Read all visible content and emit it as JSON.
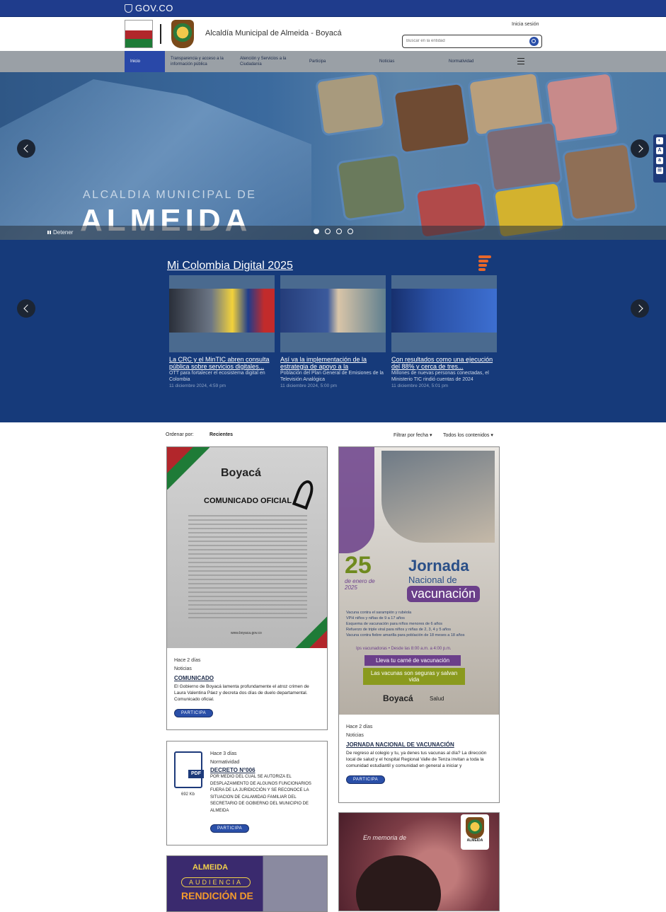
{
  "gov": {
    "brand": "GOV.CO"
  },
  "header": {
    "site_title": "Alcaldía Municipal de Almeida - Boyacá",
    "login": "Inicia sesión",
    "search_placeholder": "Buscar en la entidad"
  },
  "nav": {
    "items": [
      {
        "label": "Inicio"
      },
      {
        "label": "Transparencia y acceso a la información pública"
      },
      {
        "label": "Atención y Servicios a la Ciudadanía"
      },
      {
        "label": "Participa"
      },
      {
        "label": "Noticias"
      },
      {
        "label": "Normatividad"
      }
    ]
  },
  "hero": {
    "subtitle": "ALCALDIA MUNICIPAL DE",
    "title": "ALMEIDA",
    "stop_label": "Detener"
  },
  "digital": {
    "title": "Mi Colombia Digital 2025",
    "cards": [
      {
        "headline": "La CRC y el MinTIC abren consulta pública sobre servicios digitales...",
        "description": "OTT para fortalecer el ecosistema digital en Colombia",
        "date": "11 diciembre 2024, 4:59 pm"
      },
      {
        "headline": "Así va la implementación de la estrategia de apoyo a la",
        "description": "Población del Plan General de Emisiones de la Televisión Analógica",
        "date": "11 diciembre 2024, 5:00 pm"
      },
      {
        "headline": "Con resultados como una ejecución del 88% y cerca de tres...",
        "description": "Millones de nuevas personas conectadas, el Ministerio TIC rindió cuentas de 2024",
        "date": "11 diciembre 2024, 5:01 pm"
      }
    ]
  },
  "feed": {
    "sort_label": "Ordenar por:",
    "sort_value": "Recientes",
    "filter_date": "Filtrar por fecha",
    "filter_content": "Todos los contenidos",
    "participa": "PARTICIPA",
    "post1": {
      "poster_brand": "Boyacá",
      "poster_title": "COMUNICADO OFICIAL",
      "poster_url": "www.boyaca.gov.co",
      "age": "Hace 2 días",
      "category": "Noticias",
      "title": "COMUNICADO",
      "body": "El Gobierno de Boyacá lamenta profundamente el atroz crimen de Laura Valentina Páez y decreta dos días de duelo departamental. Comunicado oficial."
    },
    "post2": {
      "poster_day": "25",
      "poster_date": "de enero de 2025",
      "poster_title1": "Jornada",
      "poster_title2": "Nacional de",
      "poster_title3": "vacunación",
      "poster_bullets": [
        "Vacuna contra el sarampión y rubéola",
        "VPH niños y niñas de 9 a 17 años",
        "Esquema de vacunación para niños menores de 6 años",
        "Refuerzo de triple viral para niños y niñas de 2, 3, 4 y 5 años",
        "Vacuna contra fiebre amarilla para población de 18 meses a 18 años"
      ],
      "poster_place": "Ips vacunadoras • Desde las 8:00 a.m. a 4:00 p.m.",
      "poster_card": "Lleva tu carné de vacunación",
      "poster_slogan": "Las vacunas son seguras y salvan vida",
      "poster_brand": "Boyacá",
      "poster_brand_sub": "Salud",
      "age": "Hace 2 días",
      "category": "Noticias",
      "title": "JORNADA NACIONAL DE VACUNACIÓN",
      "body": "De regreso al colegio y tu, ya denes tus vacunas al día? La dirección local de salud y el hospital Regional Valle de Tenza invitan a toda la comunidad estudiantil y comunidad en general a iniciar y"
    },
    "post3": {
      "file_type": "PDF",
      "file_size": "692 Kb",
      "age": "Hace 3 días",
      "category": "Normatividad",
      "title": "DECRETO N°006",
      "body": "POR MEDIO DEL CUAL SE AUTORIZA EL DESPLAZAMIENTO DE ALGUNOS FUNCIONARIOS FUERA DE LA JURIDICCIÓN Y SE RECONOCE LA SITUACION DE CALAMIDAD FAMILIAR DEL SECRETARIO DE GOBIERNO DEL MUNICIPIO DE ALMEIDA"
    },
    "post4": {
      "brand": "ALMEIDA",
      "tag": "AUDIENCIA",
      "text": "RENDICIÓN DE"
    },
    "post5": {
      "text": "En memoria de",
      "brand": "ALMEIDA"
    }
  }
}
